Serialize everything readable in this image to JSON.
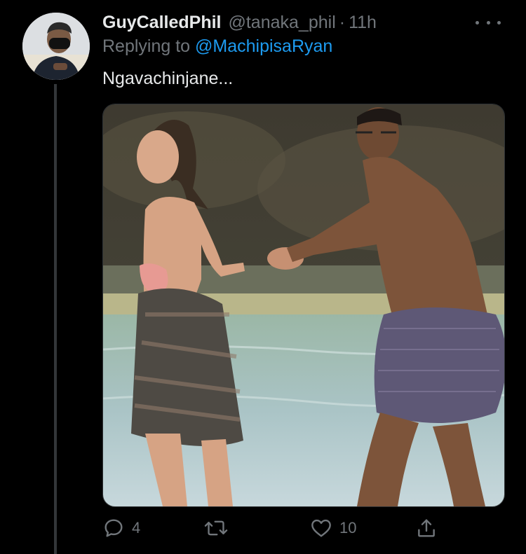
{
  "tweet": {
    "display_name": "GuyCalledPhil",
    "handle": "@tanaka_phil",
    "separator": "·",
    "time": "11h",
    "replying_prefix": "Replying to",
    "replying_to": "@MachipisaRyan",
    "text": "Ngavachinjane..."
  },
  "actions": {
    "reply_icon": "reply-icon",
    "reply_count": "4",
    "retweet_icon": "retweet-icon",
    "retweet_count": "",
    "like_icon": "heart-icon",
    "like_count": "10",
    "share_icon": "share-icon"
  },
  "colors": {
    "background": "#000000",
    "primary_text": "#e7e9ea",
    "secondary_text": "#71767b",
    "link": "#1d9bf0",
    "thread_line": "#333639"
  }
}
